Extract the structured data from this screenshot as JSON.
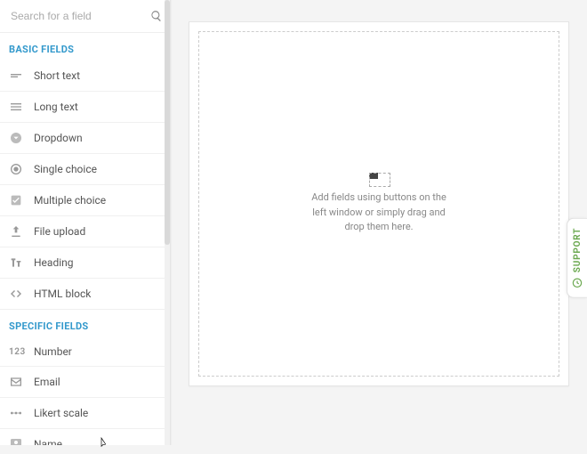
{
  "search": {
    "placeholder": "Search for a field"
  },
  "groups": {
    "basic": {
      "title": "BASIC FIELDS",
      "items": [
        {
          "label": "Short text"
        },
        {
          "label": "Long text"
        },
        {
          "label": "Dropdown"
        },
        {
          "label": "Single choice"
        },
        {
          "label": "Multiple choice"
        },
        {
          "label": "File upload"
        },
        {
          "label": "Heading"
        },
        {
          "label": "HTML block"
        }
      ]
    },
    "specific": {
      "title": "SPECIFIC FIELDS",
      "items": [
        {
          "label": "Number"
        },
        {
          "label": "Email"
        },
        {
          "label": "Likert scale"
        },
        {
          "label": "Name"
        }
      ]
    }
  },
  "canvas": {
    "help_text": "Add fields using buttons on the left window or simply drag and drop them here."
  },
  "support": {
    "label": "SUPPORT"
  }
}
